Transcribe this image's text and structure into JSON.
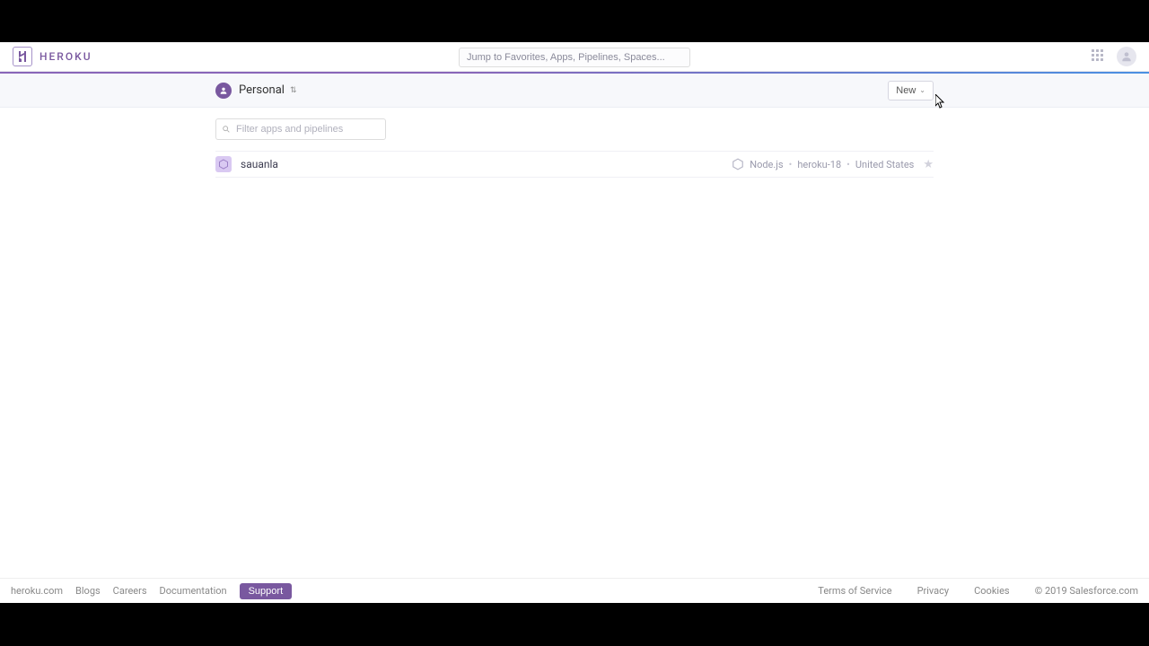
{
  "header": {
    "brand": "HEROKU",
    "search_placeholder": "Jump to Favorites, Apps, Pipelines, Spaces..."
  },
  "subheader": {
    "team_name": "Personal",
    "new_button": "New"
  },
  "filter": {
    "placeholder": "Filter apps and pipelines"
  },
  "apps": [
    {
      "name": "sauanla",
      "stack_lang": "Node.js",
      "stack_ver": "heroku-18",
      "region": "United States"
    }
  ],
  "footer": {
    "links": [
      "heroku.com",
      "Blogs",
      "Careers",
      "Documentation"
    ],
    "support": "Support",
    "right_links": [
      "Terms of Service",
      "Privacy",
      "Cookies"
    ],
    "copyright": "© 2019 Salesforce.com"
  }
}
